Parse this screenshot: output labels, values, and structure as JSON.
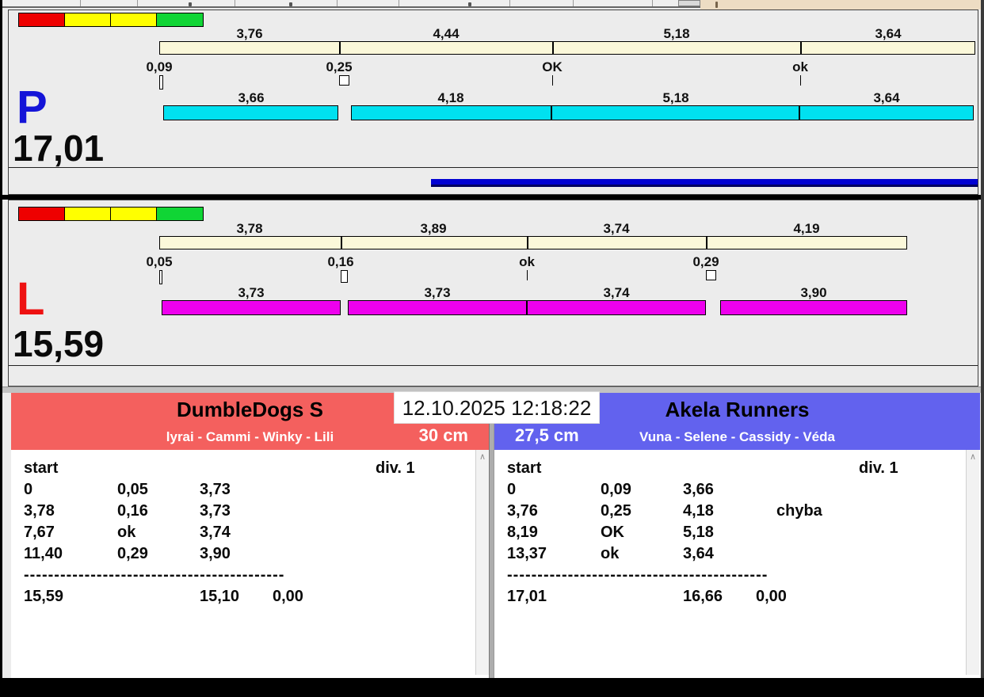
{
  "window": {
    "datetime": "12.10.2025 12:18:22"
  },
  "icons": {
    "scroll_up": "∧"
  },
  "colors": {
    "team_red": "#f4605e",
    "team_blue": "#6262ee",
    "bar_cream": "#fbf8da",
    "bar_cyan": "#00e1f0",
    "bar_magenta": "#ee00ee",
    "progress_blue": "#0000d2",
    "lane_p_letter": "#1414d8",
    "lane_l_letter": "#ee1111",
    "traffic_red": "#ee0000",
    "traffic_yellow": "#ffff00",
    "traffic_green": "#10d535",
    "toolbar_tan": "#eddcc3"
  },
  "lanes": [
    {
      "id": "P",
      "label": "P",
      "total": "17,01",
      "splits": [
        "3,76",
        "4,44",
        "5,18",
        "3,64"
      ],
      "crossovers": [
        "0,09",
        "0,25",
        "OK",
        "ok"
      ],
      "runs": [
        "3,66",
        "4,18",
        "5,18",
        "3,64"
      ],
      "bar_color": "bar_cyan",
      "progress_bar": true
    },
    {
      "id": "L",
      "label": "L",
      "total": "15,59",
      "splits": [
        "3,78",
        "3,89",
        "3,74",
        "4,19"
      ],
      "crossovers": [
        "0,05",
        "0,16",
        "ok",
        "0,29"
      ],
      "runs": [
        "3,73",
        "3,73",
        "3,74",
        "3,90"
      ],
      "bar_color": "bar_magenta",
      "progress_bar": false
    }
  ],
  "teams": [
    {
      "name": "DumbleDogs S",
      "dogs": "lyrai - Cammi - Winky - Lili",
      "height": "30 cm",
      "header_label": "start",
      "division": "div. 1",
      "rows": [
        [
          "0",
          "0,05",
          "3,73",
          ""
        ],
        [
          "3,78",
          "0,16",
          "3,73",
          ""
        ],
        [
          "7,67",
          "ok",
          "3,74",
          ""
        ],
        [
          "11,40",
          "0,29",
          "3,90",
          ""
        ]
      ],
      "separator": "-------------------------------------------",
      "totals": {
        "total": "15,59",
        "clean": "15,10",
        "penalty": "0,00"
      }
    },
    {
      "name": "Akela Runners",
      "dogs": "Vuna - Selene - Cassidy - Véda",
      "height": "27,5 cm",
      "header_label": "start",
      "division": "div. 1",
      "rows": [
        [
          "0",
          "0,09",
          "3,66",
          ""
        ],
        [
          "3,76",
          "0,25",
          "4,18",
          "chyba"
        ],
        [
          "8,19",
          "OK",
          "5,18",
          ""
        ],
        [
          "13,37",
          "ok",
          "3,64",
          ""
        ]
      ],
      "separator": "-------------------------------------------",
      "totals": {
        "total": "17,01",
        "clean": "16,66",
        "penalty": "0,00"
      }
    }
  ]
}
